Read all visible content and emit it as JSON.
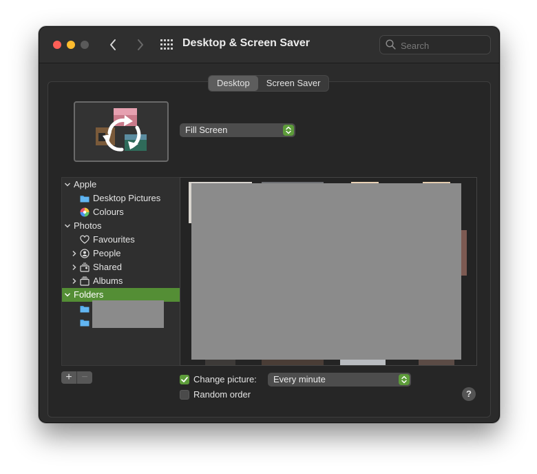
{
  "window": {
    "title": "Desktop & Screen Saver"
  },
  "search": {
    "placeholder": "Search"
  },
  "tabs": [
    {
      "label": "Desktop",
      "active": true
    },
    {
      "label": "Screen Saver",
      "active": false
    }
  ],
  "fill_mode": {
    "selected": "Fill Screen"
  },
  "sidebar": {
    "sections": [
      {
        "label": "Apple",
        "expanded": true,
        "items": [
          {
            "label": "Desktop Pictures",
            "icon": "folder-icon"
          },
          {
            "label": "Colours",
            "icon": "color-wheel-icon"
          }
        ]
      },
      {
        "label": "Photos",
        "expanded": true,
        "items": [
          {
            "label": "Favourites",
            "icon": "heart-icon"
          },
          {
            "label": "People",
            "icon": "person-icon"
          },
          {
            "label": "Shared",
            "icon": "shared-album-icon"
          },
          {
            "label": "Albums",
            "icon": "album-icon"
          }
        ]
      },
      {
        "label": "Folders",
        "expanded": true,
        "selected": true
      }
    ]
  },
  "buttons": {
    "add": "+",
    "remove": "−",
    "help": "?"
  },
  "change_picture": {
    "label": "Change picture:",
    "checked": true,
    "interval": "Every minute"
  },
  "random_order": {
    "label": "Random order",
    "checked": false
  },
  "colors": {
    "accent": "#5d9c3a",
    "selection": "#548e35",
    "window_bg": "#2b2b2b",
    "redaction": "#8b8b8b"
  }
}
